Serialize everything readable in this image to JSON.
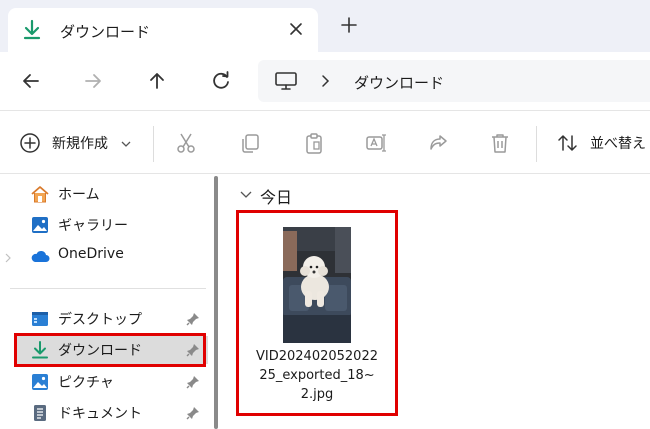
{
  "tab": {
    "title": "ダウンロード"
  },
  "address": {
    "path": "ダウンロード"
  },
  "toolbar": {
    "new_label": "新規作成",
    "sort_label": "並べ替え"
  },
  "sidebar": {
    "items": [
      {
        "label": "ホーム"
      },
      {
        "label": "ギャラリー"
      },
      {
        "label": "OneDrive"
      },
      {
        "label": "デスクトップ"
      },
      {
        "label": "ダウンロード"
      },
      {
        "label": "ピクチャ"
      },
      {
        "label": "ドキュメント"
      }
    ]
  },
  "content": {
    "group_label": "今日",
    "file": {
      "name_lines": [
        "VID202402052022",
        "25_exported_18~",
        "2.jpg"
      ]
    }
  },
  "colors": {
    "accent": "#0078d4",
    "download_green": "#1a9a6c",
    "highlight": "#e00000"
  }
}
